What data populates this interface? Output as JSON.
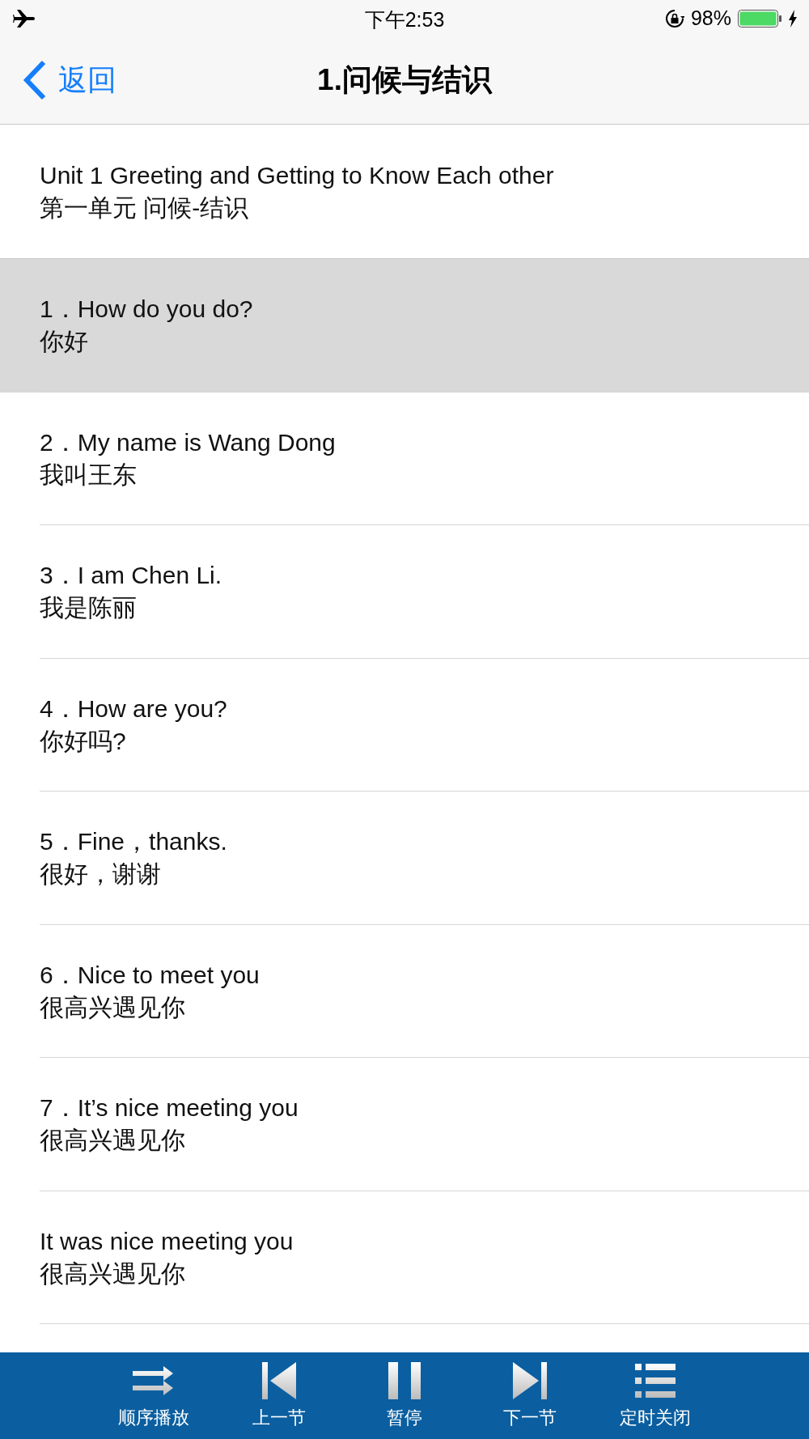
{
  "status_bar": {
    "time": "下午2:53",
    "battery": "98%"
  },
  "nav_bar": {
    "back": "返回",
    "title": "1.问候与结识"
  },
  "unit": {
    "title": "Unit 1  Greeting and Getting to Know Each other",
    "subtitle": "第一单元 问候-结识"
  },
  "lessons": [
    {
      "english": "1．How do you do?",
      "chinese": "你好",
      "selected": true
    },
    {
      "english": "2．My name is Wang Dong",
      "chinese": "我叫王东",
      "selected": false
    },
    {
      "english": "3．I am Chen Li.",
      "chinese": "我是陈丽",
      "selected": false
    },
    {
      "english": "4．How are you?",
      "chinese": "你好吗?",
      "selected": false
    },
    {
      "english": "5．Fine，thanks.",
      "chinese": "很好，谢谢",
      "selected": false
    },
    {
      "english": "6．Nice to meet you",
      "chinese": "很高兴遇见你",
      "selected": false
    },
    {
      "english": "7．It’s nice meeting you",
      "chinese": "很高兴遇见你",
      "selected": false
    },
    {
      "english": "It was nice meeting you",
      "chinese": "很高兴遇见你",
      "selected": false
    }
  ],
  "player_bar": [
    {
      "kind": "order",
      "label": "顺序播放"
    },
    {
      "kind": "prev",
      "label": "上一节"
    },
    {
      "kind": "pause",
      "label": "暂停"
    },
    {
      "kind": "next",
      "label": "下一节"
    },
    {
      "kind": "timer",
      "label": "定时关闭"
    }
  ]
}
